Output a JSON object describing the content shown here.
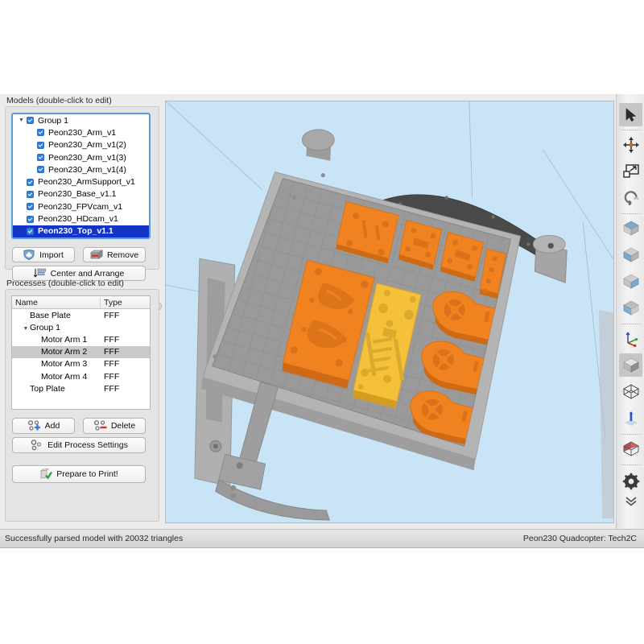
{
  "models_panel": {
    "label": "Models (double-click to edit)",
    "tree": [
      {
        "indent": 0,
        "twisty": "▼",
        "label": "Group 1",
        "checked": true,
        "selected": false
      },
      {
        "indent": 1,
        "twisty": "",
        "label": "Peon230_Arm_v1",
        "checked": true,
        "selected": false
      },
      {
        "indent": 1,
        "twisty": "",
        "label": "Peon230_Arm_v1(2)",
        "checked": true,
        "selected": false
      },
      {
        "indent": 1,
        "twisty": "",
        "label": "Peon230_Arm_v1(3)",
        "checked": true,
        "selected": false
      },
      {
        "indent": 1,
        "twisty": "",
        "label": "Peon230_Arm_v1(4)",
        "checked": true,
        "selected": false
      },
      {
        "indent": 0,
        "twisty": "",
        "label": "Peon230_ArmSupport_v1",
        "checked": true,
        "selected": false
      },
      {
        "indent": 0,
        "twisty": "",
        "label": "Peon230_Base_v1.1",
        "checked": true,
        "selected": false
      },
      {
        "indent": 0,
        "twisty": "",
        "label": "Peon230_FPVcam_v1",
        "checked": true,
        "selected": false
      },
      {
        "indent": 0,
        "twisty": "",
        "label": "Peon230_HDcam_v1",
        "checked": true,
        "selected": false
      },
      {
        "indent": 0,
        "twisty": "",
        "label": "Peon230_Top_v1.1",
        "checked": true,
        "selected": true
      }
    ],
    "import_label": "Import",
    "remove_label": "Remove",
    "center_arrange_label": "Center and Arrange"
  },
  "processes_panel": {
    "label": "Processes (double-click to edit)",
    "columns": [
      "Name",
      "Type"
    ],
    "rows": [
      {
        "indent": 0,
        "twisty": "",
        "name": "Base Plate",
        "type": "FFF",
        "selected": false
      },
      {
        "indent": 1,
        "twisty": "▼",
        "name": "Group 1",
        "type": "",
        "selected": false
      },
      {
        "indent": 2,
        "twisty": "",
        "name": "Motor Arm 1",
        "type": "FFF",
        "selected": false
      },
      {
        "indent": 2,
        "twisty": "",
        "name": "Motor Arm 2",
        "type": "FFF",
        "selected": true
      },
      {
        "indent": 2,
        "twisty": "",
        "name": "Motor Arm 3",
        "type": "FFF",
        "selected": false
      },
      {
        "indent": 2,
        "twisty": "",
        "name": "Motor Arm 4",
        "type": "FFF",
        "selected": false
      },
      {
        "indent": 0,
        "twisty": "",
        "name": "Top Plate",
        "type": "FFF",
        "selected": false
      }
    ],
    "add_label": "Add",
    "delete_label": "Delete",
    "edit_label": "Edit Process Settings",
    "prepare_label": "Prepare to Print!"
  },
  "toolbar": {
    "items": [
      {
        "icon": "cursor-arrow-icon",
        "active": true
      },
      {
        "icon": "pan-move-icon",
        "active": false
      },
      {
        "icon": "scale-resize-icon",
        "active": false
      },
      {
        "icon": "rotate-icon",
        "active": false
      },
      {
        "icon": "view-cube-top-icon",
        "active": false
      },
      {
        "icon": "view-cube-front-icon",
        "active": false
      },
      {
        "icon": "view-cube-side-icon",
        "active": false
      },
      {
        "icon": "view-cube-iso-icon",
        "active": false
      },
      {
        "icon": "axes-origin-icon",
        "active": false
      },
      {
        "icon": "solid-shading-icon",
        "active": true
      },
      {
        "icon": "wireframe-shading-icon",
        "active": false
      },
      {
        "icon": "support-pillar-icon",
        "active": false
      },
      {
        "icon": "cross-section-icon",
        "active": false
      },
      {
        "icon": "settings-gear-icon",
        "active": false
      },
      {
        "icon": "chevron-double-down-icon",
        "active": false
      }
    ]
  },
  "status_bar": {
    "message": "Successfully parsed model with 20032 triangles",
    "project": "Peon230 Quadcopter: Tech2C"
  },
  "colors": {
    "viewport_background": "#c9e4f7",
    "part_orange": "#f0821f",
    "part_yellow": "#f5c13a",
    "bed_gray": "#9a9a9a",
    "printer_gray": "#a8a8a8",
    "selection_blue": "#1334c4",
    "checkbox_blue": "#2f7fe0"
  }
}
